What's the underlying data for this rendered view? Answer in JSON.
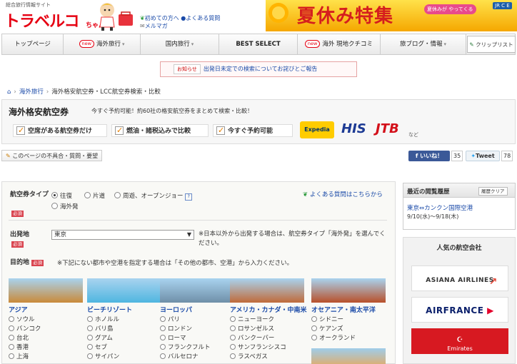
{
  "header": {
    "site_tag": "総合旅行情報サイト",
    "logo_text": "トラベルコ",
    "logo_suffix": "ちゃん",
    "links": [
      "初めての方へ",
      "よくある質問",
      "メルマガ"
    ],
    "banner_text": "夏休み特集",
    "banner_sub": "夏休みが やってくる",
    "banner_badge": "JR C E"
  },
  "nav": {
    "items": [
      {
        "label": "トップページ",
        "new": false,
        "caret": false
      },
      {
        "label": "海外旅行",
        "new": true,
        "caret": true
      },
      {
        "label": "国内旅行",
        "new": false,
        "caret": true
      },
      {
        "label": "BEST SELECT",
        "new": false,
        "caret": false
      },
      {
        "label": "海外 現地クチコミ",
        "new": true,
        "caret": false
      },
      {
        "label": "旅ブログ・情報",
        "new": false,
        "caret": true
      }
    ],
    "new_label": "new",
    "clip_label": "クリップリスト"
  },
  "notice": {
    "label": "お知らせ",
    "text": "出発日未定での検索についてお詫びとご報告"
  },
  "breadcrumb": [
    "海外旅行",
    "海外格安航空券・LCC航空券検索・比較"
  ],
  "search_box": {
    "title": "海外格安航空券",
    "subtitle": "今すぐ予約可能！約60社の格安航空券をまとめて検索・比較！",
    "features": [
      "空席がある航空券だけ",
      "燃油・諸税込みで比較",
      "今すぐ予約可能"
    ],
    "partners": [
      "Expedia",
      "HIS",
      "JTB"
    ],
    "partners_suffix": "など"
  },
  "feedback_label": "このページの不具合・質問・要望",
  "social": {
    "fb_label": "いいね！",
    "fb_count": "35",
    "tw_label": "Tweet",
    "tw_count": "78"
  },
  "form": {
    "trip_type_label": "航空券タイプ",
    "required_label": "必須",
    "trip_types": [
      "往復",
      "片道",
      "周遊、オープンジョー",
      "海外発"
    ],
    "faq_link": "よくある質問はこちらから",
    "departure_label": "出発地",
    "departure_value": "東京",
    "departure_note": "※日本以外から出発する場合は、航空券タイプ「海外発」を選んでください。",
    "destination_label": "目的地",
    "destination_note": "※下記にない都市や空港を指定する場合は「その他の都市、空港」から入力ください。",
    "regions": [
      {
        "title": "アジア",
        "cities": [
          "ソウル",
          "バンコク",
          "台北",
          "香港",
          "上海"
        ],
        "color": "#c98a3a"
      },
      {
        "title": "ビーチリゾート",
        "cities": [
          "ホノルル",
          "バリ島",
          "グアム",
          "セブ",
          "サイパン"
        ],
        "color": "#4fb6e0"
      },
      {
        "title": "ヨーロッパ",
        "cities": [
          "パリ",
          "ロンドン",
          "ローマ",
          "フランクフルト",
          "バルセロナ"
        ],
        "color": "#6f8fa8"
      },
      {
        "title": "アメリカ・カナダ・中南米",
        "cities": [
          "ニューヨーク",
          "ロサンゼルス",
          "バンクーバー",
          "サンフランシスコ",
          "ラスベガス"
        ],
        "color": "#c06a3a"
      },
      {
        "title": "オセアニア・南太平洋",
        "cities": [
          "シドニー",
          "ケアンズ",
          "オークランド"
        ],
        "color": "#b8502a"
      }
    ]
  },
  "sidebar": {
    "history_title": "最近の閲覧履歴",
    "history_button": "履歴クリア",
    "history_item": "東京⇔カンクン国際空港",
    "history_date": "9/10(水)～9/18(木)",
    "popular_title": "人気の航空会社",
    "airlines": [
      "ASIANA AIRLINES",
      "AIRFRANCE",
      "Emirates"
    ]
  }
}
